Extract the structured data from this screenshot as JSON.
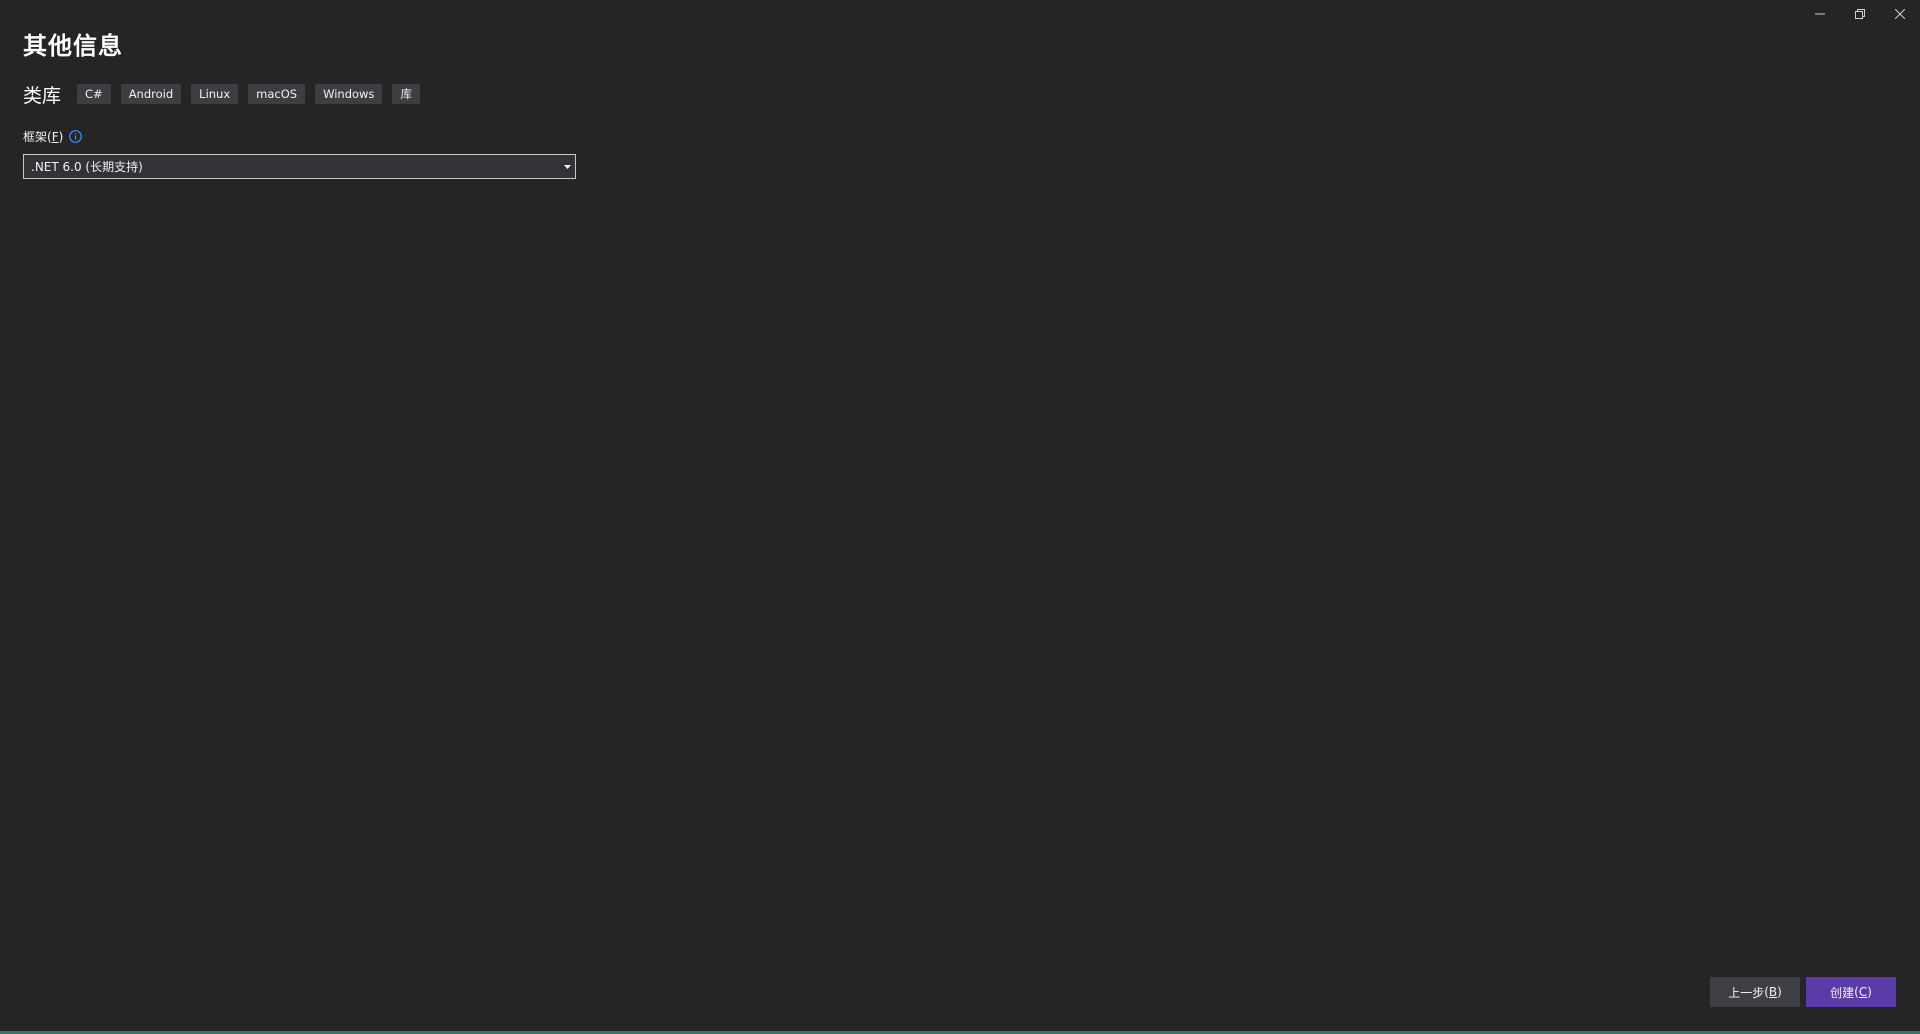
{
  "window_controls": {
    "minimize": "minimize",
    "restore": "restore",
    "close": "close"
  },
  "page": {
    "title": "其他信息"
  },
  "template": {
    "name": "类库",
    "tags": [
      "C#",
      "Android",
      "Linux",
      "macOS",
      "Windows",
      "库"
    ]
  },
  "framework": {
    "label": "框架",
    "label_mnemonic": "(F)",
    "mnemonic_letter": "F",
    "selected": ".NET 6.0 (长期支持)"
  },
  "buttons": {
    "back_label": "上一步",
    "back_mnemonic_open": "(",
    "back_mnemonic": "B",
    "back_mnemonic_close": ")",
    "create_label": "创建",
    "create_mnemonic_open": "(",
    "create_mnemonic": "C",
    "create_mnemonic_close": ")"
  },
  "colors": {
    "background": "#252526",
    "tag_background": "#3e3e42",
    "primary_button": "#5b3ba8",
    "secondary_button": "#3f3f46",
    "info_icon": "#3794ff",
    "bottom_border": "#2f7a6a"
  }
}
